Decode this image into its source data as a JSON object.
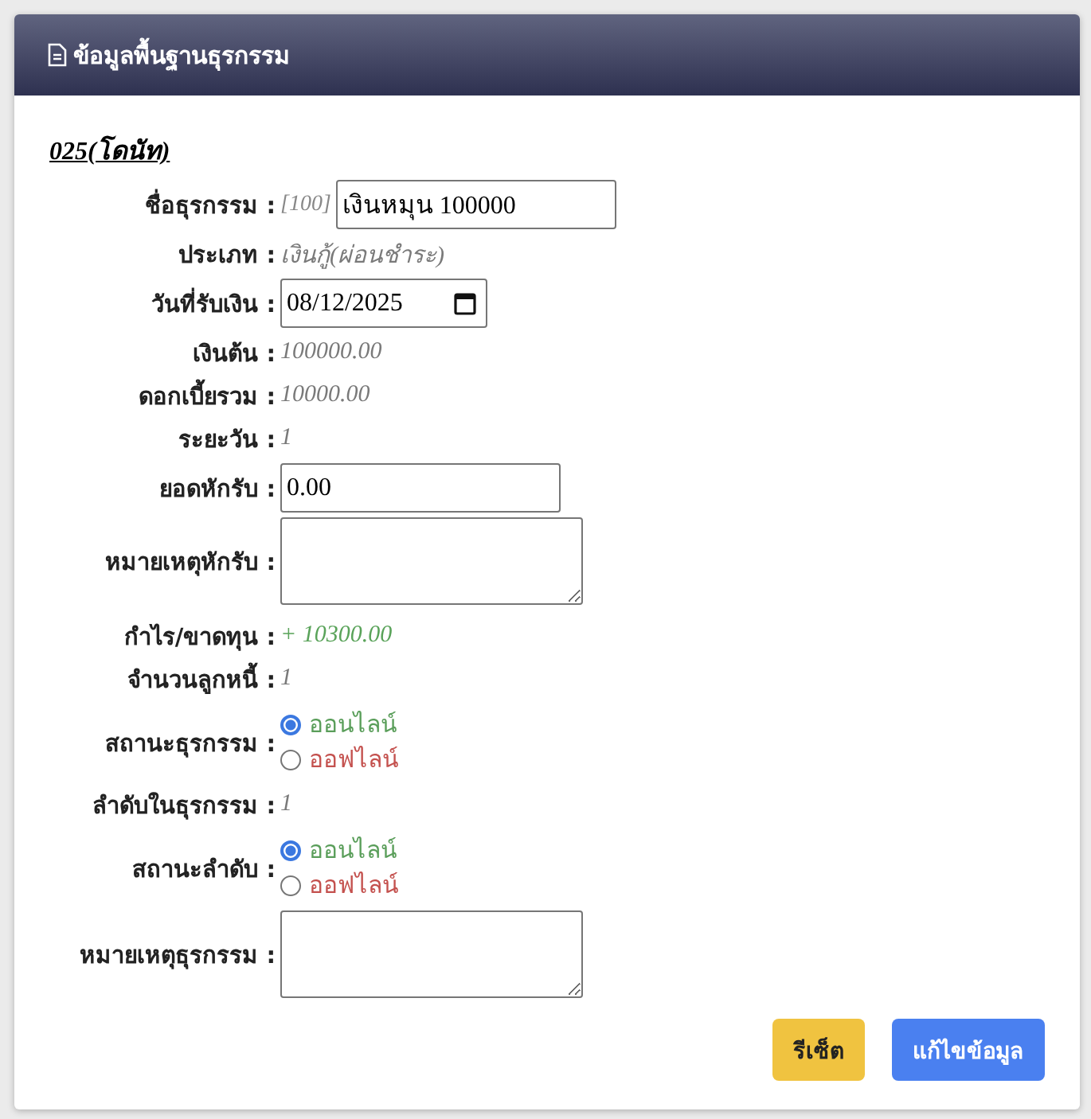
{
  "header": {
    "title": "ข้อมูลพื้นฐานธุรกรรม"
  },
  "record_title": "025(โดนัท)",
  "fields": [
    {
      "kind": "input",
      "label": "ชื่อธุรกรรม :",
      "prefix": "[100]",
      "value": "เงินหมุน 100000"
    },
    {
      "kind": "text",
      "label": "ประเภท :",
      "value": "เงินกู้(ผ่อนชำระ)"
    },
    {
      "kind": "date",
      "label": "วันที่รับเงิน :",
      "value": "08/12/2025"
    },
    {
      "kind": "text",
      "label": "เงินต้น :",
      "value": "100000.00"
    },
    {
      "kind": "text",
      "label": "ดอกเบี้ยรวม :",
      "value": "10000.00"
    },
    {
      "kind": "text",
      "label": "ระยะวัน :",
      "value": "1"
    },
    {
      "kind": "input",
      "label": "ยอดหักรับ :",
      "value": "0.00"
    },
    {
      "kind": "textarea",
      "label": "หมายเหตุหักรับ :"
    },
    {
      "kind": "text",
      "label": "กำไร/ขาดทุน :",
      "value": "+ 10300.00",
      "color": "#5aa35a"
    },
    {
      "kind": "text",
      "label": "จำนวนลูกหนี้ :",
      "value": "1"
    },
    {
      "kind": "radio",
      "label": "สถานะธุรกรรม :",
      "options": [
        {
          "label": "ออนไลน์",
          "selected": true,
          "color": "#5a9e5a"
        },
        {
          "label": "ออฟไลน์",
          "selected": false,
          "color": "#c4514e"
        }
      ]
    },
    {
      "kind": "text",
      "label": "ลำดับในธุรกรรม :",
      "value": "1"
    },
    {
      "kind": "radio",
      "label": "สถานะลำดับ :",
      "options": [
        {
          "label": "ออนไลน์",
          "selected": true,
          "color": "#5a9e5a"
        },
        {
          "label": "ออฟไลน์",
          "selected": false,
          "color": "#c4514e"
        }
      ]
    },
    {
      "kind": "textarea",
      "label": "หมายเหตุธุรกรรม :"
    }
  ],
  "buttons": [
    {
      "kind": "warning",
      "label": "รีเซ็ต"
    },
    {
      "kind": "primary",
      "label": "แก้ไขข้อมูล"
    }
  ]
}
